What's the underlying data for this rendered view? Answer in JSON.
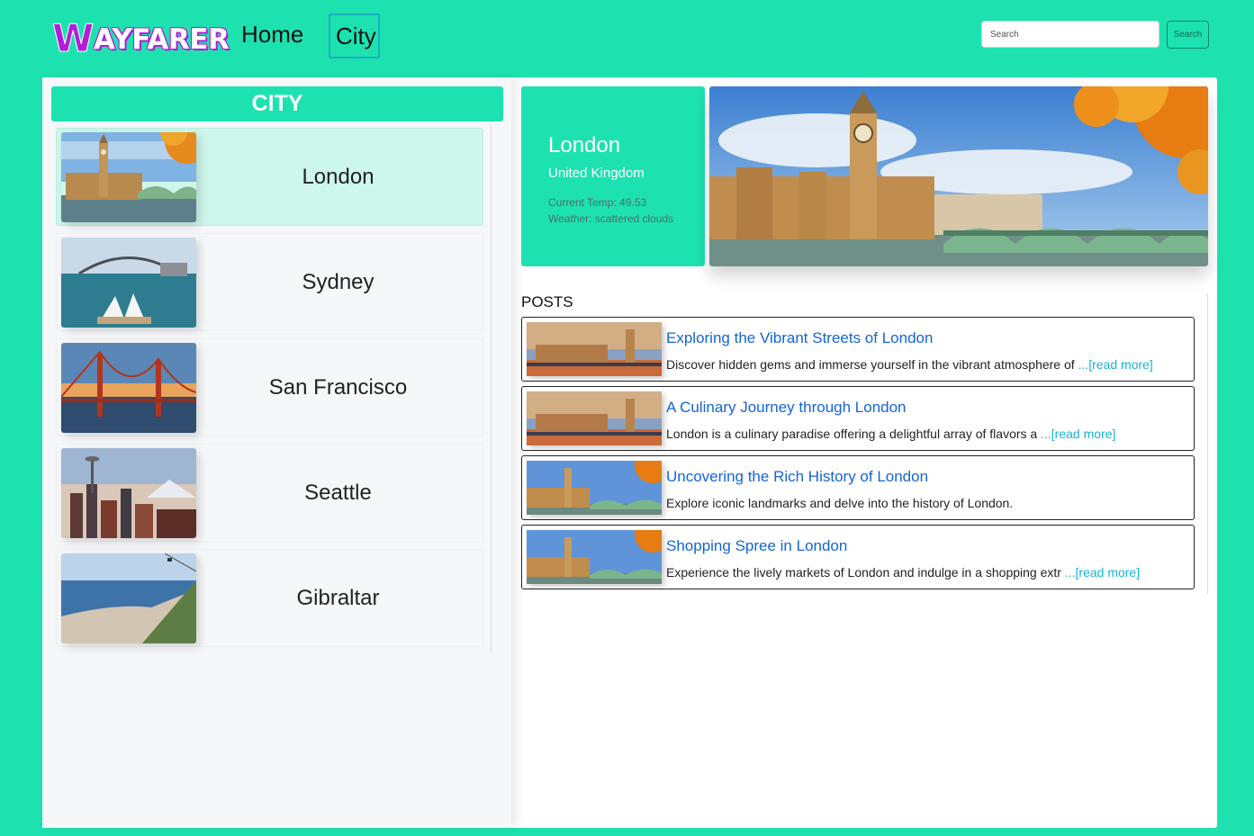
{
  "brand": {
    "logo_initial": "W",
    "logo_rest": "AYFARER"
  },
  "nav": {
    "home": "Home",
    "city": "City"
  },
  "search": {
    "placeholder": "Search",
    "button": "Search"
  },
  "cities_panel": {
    "header": "CITY",
    "items": [
      {
        "name": "London",
        "active": true
      },
      {
        "name": "Sydney",
        "active": false
      },
      {
        "name": "San Francisco",
        "active": false
      },
      {
        "name": "Seattle",
        "active": false
      },
      {
        "name": "Gibraltar",
        "active": false
      }
    ]
  },
  "city_info": {
    "city": "London",
    "country": "United Kingdom",
    "temp": "Current Temp: 49.53",
    "weather": "Weather: scattered clouds"
  },
  "posts": {
    "title": "POSTS",
    "read_more": "...[read more]",
    "items": [
      {
        "title": "Exploring the Vibrant Streets of London",
        "body": "Discover hidden gems and immerse yourself in the vibrant atmosphere of ",
        "has_more": true
      },
      {
        "title": "A Culinary Journey through London",
        "body": "London is a culinary paradise offering a delightful array of flavors a ",
        "has_more": true
      },
      {
        "title": "Uncovering the Rich History of London",
        "body": "Explore iconic landmarks and delve into the history of London.",
        "has_more": false
      },
      {
        "title": "Shopping Spree in London",
        "body": "Experience the lively markets of London and indulge in a shopping extr ",
        "has_more": true
      }
    ]
  },
  "colors": {
    "accent": "#1de2b0",
    "logo": "#b21cd8",
    "link": "#1465d6",
    "read_more": "#15b4d8"
  }
}
